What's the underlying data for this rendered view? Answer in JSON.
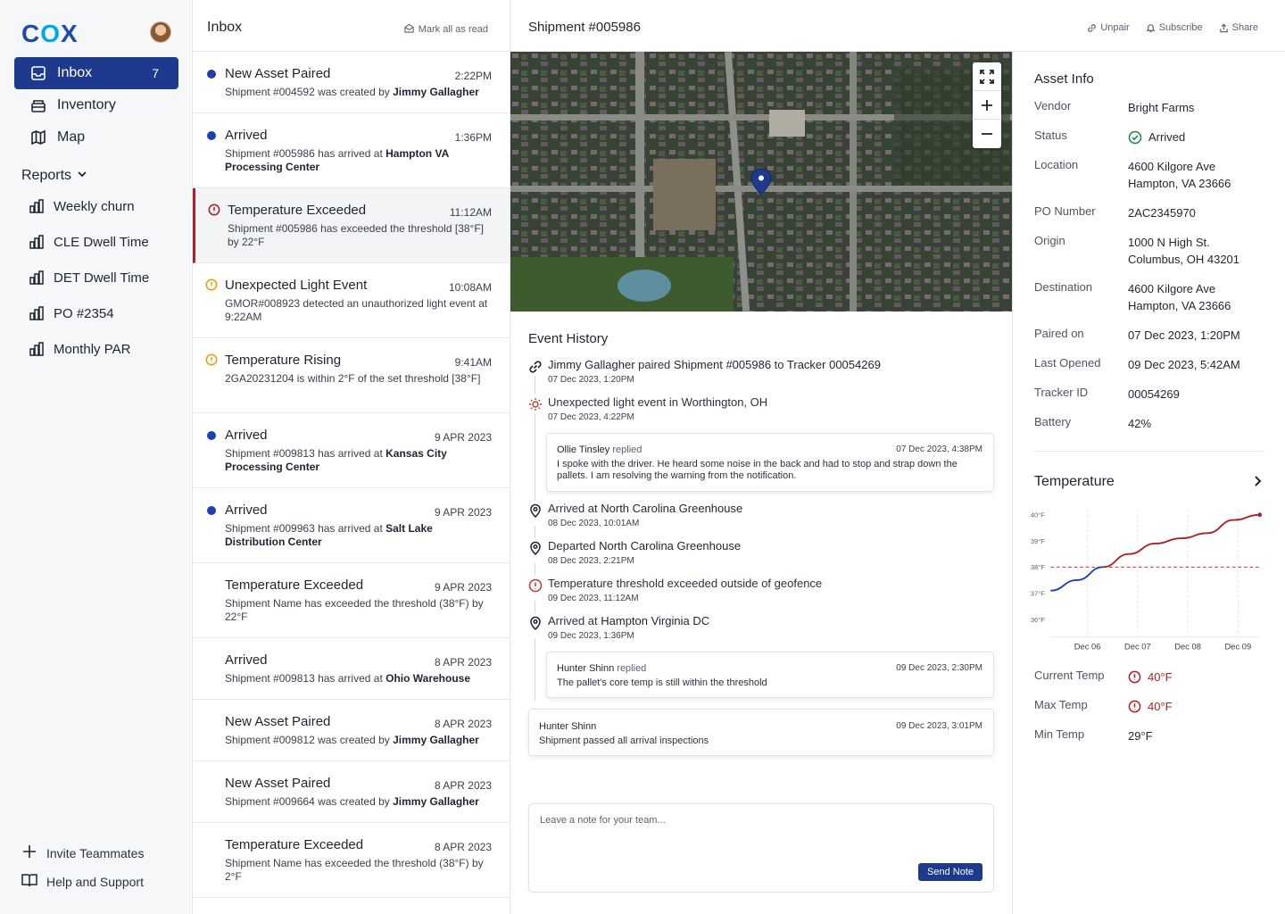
{
  "app": {
    "logo": "COX"
  },
  "sidebar": {
    "nav": [
      {
        "label": "Inbox",
        "count": "7",
        "icon": "inbox-icon"
      },
      {
        "label": "Inventory",
        "icon": "package-icon"
      },
      {
        "label": "Map",
        "icon": "map-icon"
      }
    ],
    "reports_label": "Reports",
    "reports": [
      {
        "label": "Weekly churn"
      },
      {
        "label": "CLE Dwell Time"
      },
      {
        "label": "DET Dwell Time"
      },
      {
        "label": "PO #2354"
      },
      {
        "label": "Monthly PAR"
      }
    ],
    "invite": "Invite Teammates",
    "help": "Help and Support"
  },
  "inbox": {
    "title": "Inbox",
    "mark_all": "Mark all as read",
    "messages": [
      {
        "title": "New Asset Paired",
        "time": "2:22PM",
        "pre": "Shipment #004592 was created by ",
        "bold": "Jimmy Gallagher",
        "post": "",
        "marker": "dot"
      },
      {
        "title": "Arrived",
        "time": "1:36PM",
        "pre": "Shipment #005986 has arrived at ",
        "bold": "Hampton VA Processing Center",
        "post": "",
        "marker": "dot"
      },
      {
        "title": "Temperature Exceeded",
        "time": "11:12AM",
        "pre": "Shipment #005986 has exceeded the threshold [38°F] by 22°F",
        "bold": "",
        "post": "",
        "marker": "red"
      },
      {
        "title": "Unexpected Light Event",
        "time": "10:08AM",
        "pre": "GMOR#008923 detected an unauthorized light event at 9:22AM",
        "bold": "",
        "post": "",
        "marker": "amber"
      },
      {
        "title": "Temperature Rising",
        "time": "9:41AM",
        "pre": "2GA20231204 is within 2°F of the set threshold [38°F]",
        "bold": "",
        "post": "",
        "marker": "amber"
      },
      {
        "title": "Arrived",
        "time": "9 APR 2023",
        "pre": "Shipment #009813 has arrived at ",
        "bold": "Kansas City Processing Center",
        "post": "",
        "marker": "dot"
      },
      {
        "title": "Arrived",
        "time": "9 APR 2023",
        "pre": "Shipment #009963 has arrived at ",
        "bold": "Salt Lake Distribution Center",
        "post": "",
        "marker": "dot"
      },
      {
        "title": "Temperature Exceeded",
        "time": "9 APR 2023",
        "pre": "Shipment Name has exceeded the threshold (38°F) by 22°F",
        "bold": "",
        "post": "",
        "marker": "none"
      },
      {
        "title": "Arrived",
        "time": "8 APR 2023",
        "pre": "Shipment #009813 has arrived at ",
        "bold": "Ohio Warehouse",
        "post": "",
        "marker": "none"
      },
      {
        "title": "New Asset Paired",
        "time": "8 APR 2023",
        "pre": "Shipment #009812 was created by ",
        "bold": "Jimmy Gallagher",
        "post": "",
        "marker": "none"
      },
      {
        "title": "New Asset Paired",
        "time": "8 APR 2023",
        "pre": "Shipment #009664 was created by ",
        "bold": "Jimmy Gallagher",
        "post": "",
        "marker": "none"
      },
      {
        "title": "Temperature Exceeded",
        "time": "8 APR 2023",
        "pre": "Shipment Name has exceeded the threshold (38°F) by 2°F",
        "bold": "",
        "post": "",
        "marker": "none"
      }
    ]
  },
  "main": {
    "title": "Shipment #005986",
    "actions": {
      "unpair": "Unpair",
      "subscribe": "Subscribe",
      "share": "Share"
    },
    "event_history_title": "Event History",
    "events": [
      {
        "a": "Jimmy Gallagher",
        "b": " paired ",
        "c": "Shipment #005986",
        "d": " to ",
        "e": "Tracker 00054269",
        "date": "07 Dec 2023, 1:20PM"
      },
      {
        "text": "Unexpected light event in Worthington, OH",
        "date": "07 Dec 2023, 4:22PM"
      },
      {
        "pre": "Arrived at ",
        "place": "North Carolina Greenhouse",
        "date": "08 Dec 2023, 10:01AM"
      },
      {
        "pre": "Departed ",
        "place": "North Carolina Greenhouse",
        "date": "08 Dec 2023, 2:21PM"
      },
      {
        "text": "Temperature threshold exceeded outside of geofence",
        "date": "09 Dec 2023, 11:12AM"
      },
      {
        "pre": "Arrived at ",
        "place": "Hampton Virginia DC",
        "date": "09 Dec 2023, 1:36PM"
      }
    ],
    "replies": [
      {
        "name": "Ollie Tinsley",
        "verb": "replied",
        "when": "07 Dec 2023, 4:38PM",
        "text": "I spoke with the driver. He heard some noise in the back and had to stop and strap down the pallets. I am resolving the warning from the notification."
      },
      {
        "name": "Hunter Shinn",
        "verb": "replied",
        "when": "09 Dec 2023, 2:30PM",
        "text": "The pallet's core temp is still within the threshold"
      }
    ],
    "note": {
      "name": "Hunter Shinn",
      "when": "09 Dec 2023, 3:01PM",
      "text": "Shipment passed all arrival inspections"
    },
    "compose": {
      "placeholder": "Leave a note for your team...",
      "send": "Send Note"
    }
  },
  "asset": {
    "title": "Asset Info",
    "rows": [
      {
        "k": "Vendor",
        "v": "Bright Farms"
      },
      {
        "k": "Status",
        "v": "Arrived"
      },
      {
        "k": "Location",
        "v": "4600 Kilgore Ave",
        "v2": "Hampton, VA  23666"
      },
      {
        "k": "PO Number",
        "v": "2AC2345970"
      },
      {
        "k": "Origin",
        "v": "1000 N High St.",
        "v2": "Columbus, OH  43201"
      },
      {
        "k": "Destination",
        "v": "4600 Kilgore Ave",
        "v2": "Hampton, VA  23666"
      },
      {
        "k": "Paired on",
        "v": "07 Dec 2023, 1:20PM"
      },
      {
        "k": "Last Opened",
        "v": "09 Dec 2023, 5:42AM"
      },
      {
        "k": "Tracker ID",
        "v": "00054269"
      },
      {
        "k": "Battery",
        "v": "42%"
      }
    ],
    "temperature_title": "Temperature",
    "temps": [
      {
        "k": "Current Temp",
        "v": "40°F"
      },
      {
        "k": "Max Temp",
        "v": "40°F"
      },
      {
        "k": "Min Temp",
        "v": "29°F"
      }
    ]
  },
  "chart_data": {
    "type": "line",
    "x": [
      "Dec 05",
      "Dec 06",
      "Dec 06.5",
      "Dec 07",
      "Dec 07.5",
      "Dec 08",
      "Dec 08.5",
      "Dec 09",
      "Dec 09.5"
    ],
    "categories": [
      "Dec 06",
      "Dec 07",
      "Dec 08",
      "Dec 09"
    ],
    "y_ticks": [
      "40°F",
      "39°F",
      "38°F",
      "37°F",
      "36°F"
    ],
    "ylim": [
      36,
      40
    ],
    "threshold": 38,
    "series": [
      {
        "values": [
          37.1,
          37.5,
          38.0,
          38.5,
          38.9,
          39.1,
          39.3,
          39.8,
          40.0
        ]
      }
    ],
    "colors": {
      "below": "#1d3fb0",
      "above": "#a8232a"
    },
    "grid": true
  }
}
